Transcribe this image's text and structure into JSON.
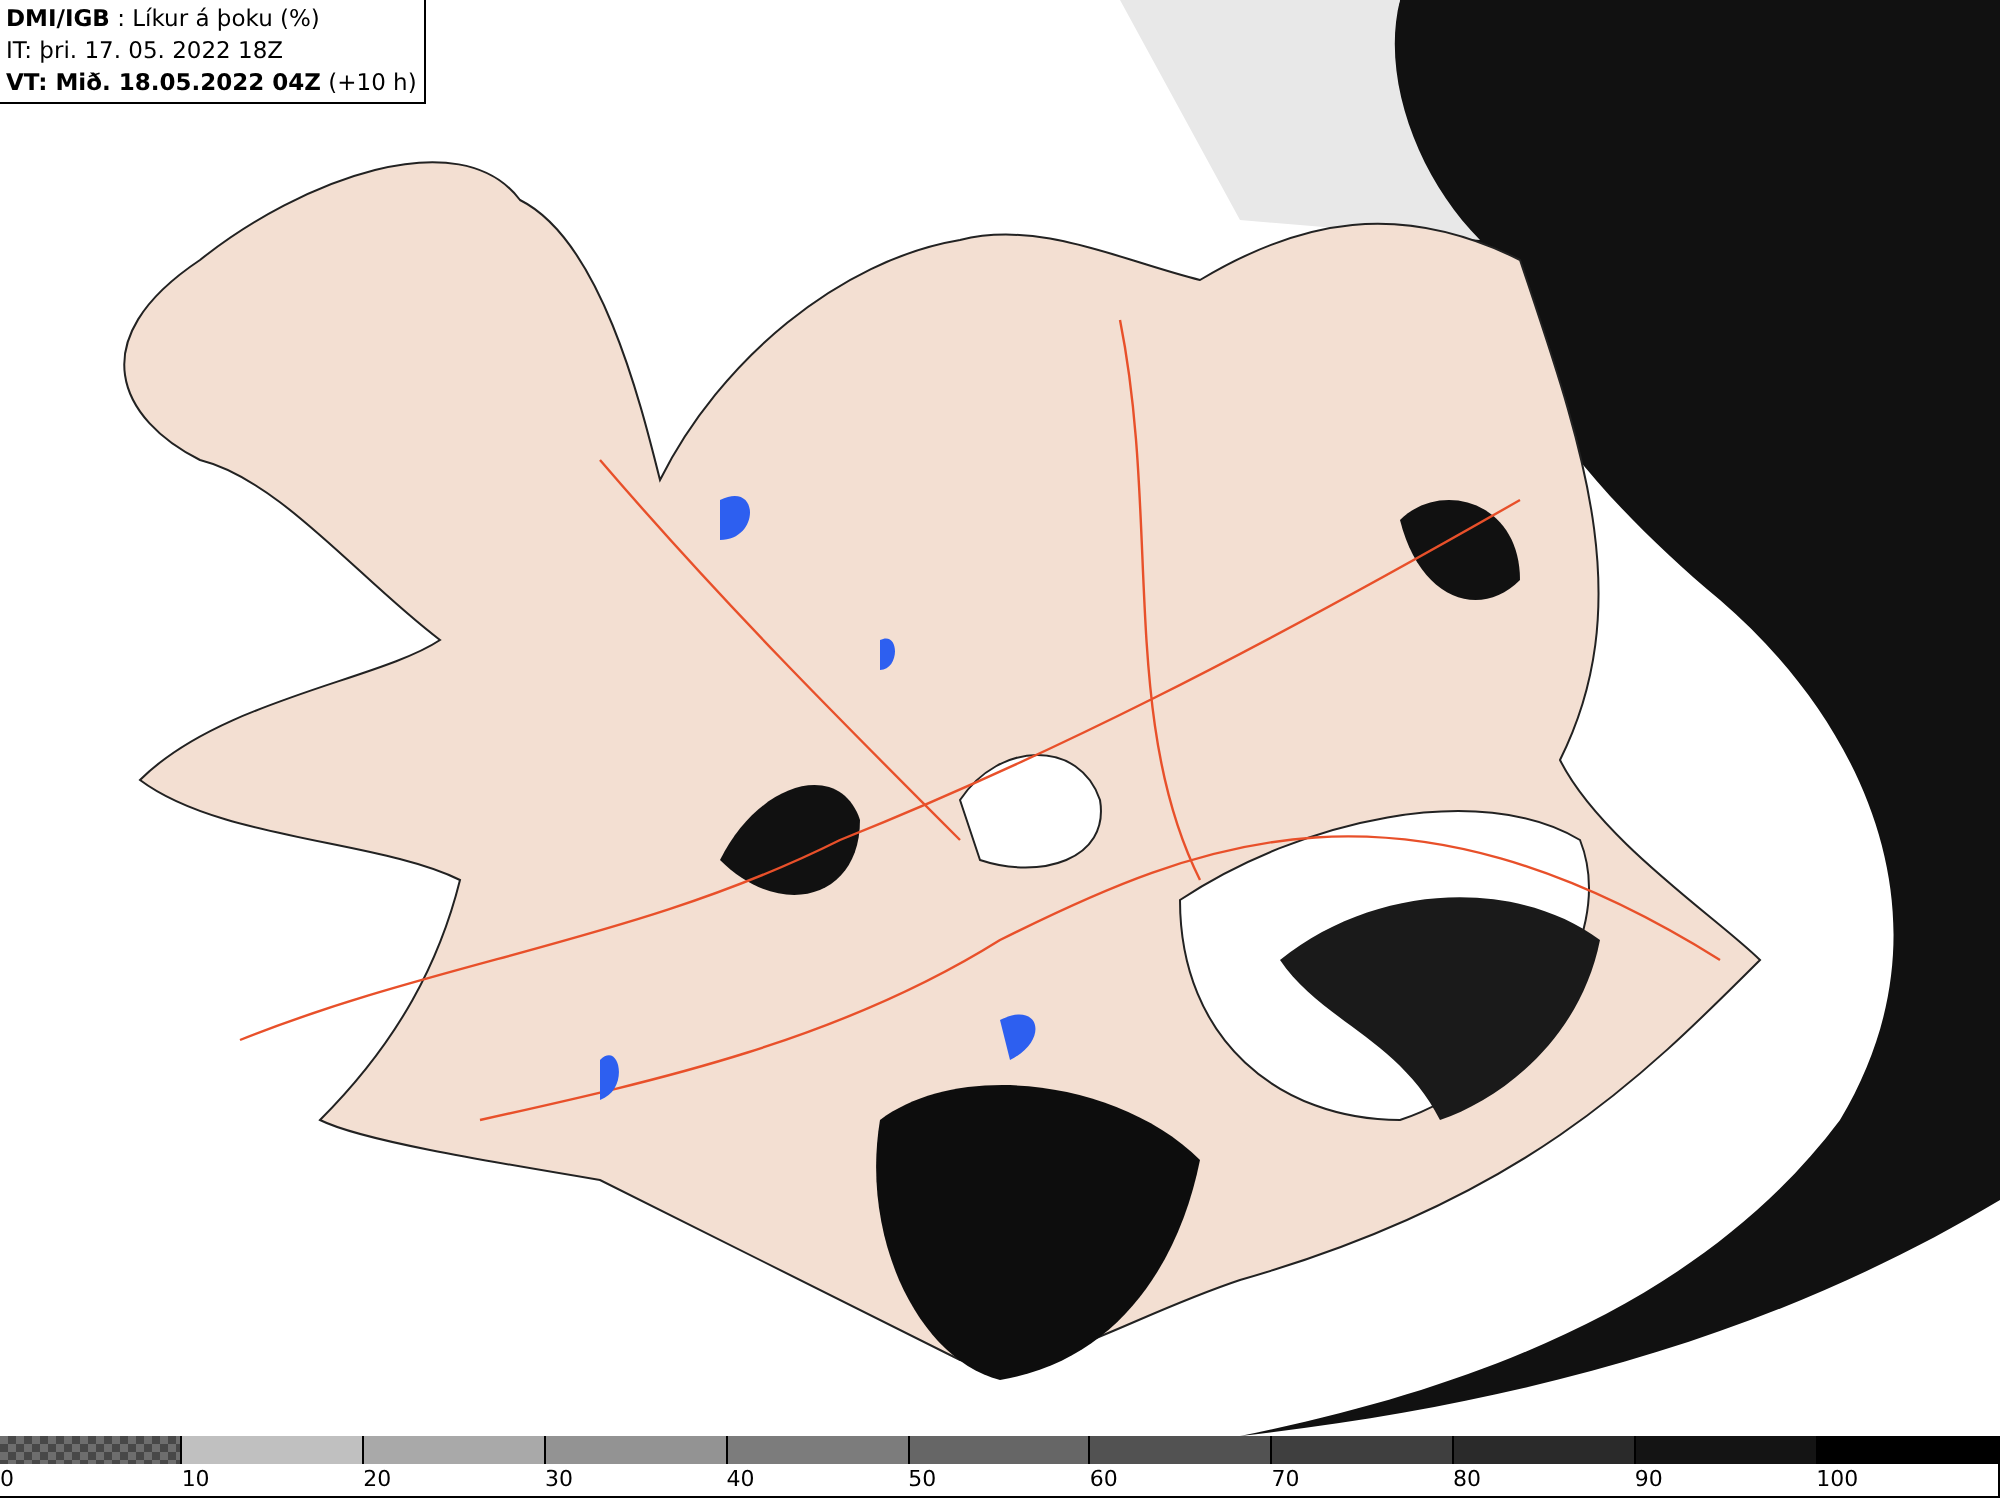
{
  "header": {
    "source": "DMI/IGB",
    "title": " : Líkur á þoku (%)",
    "issued": "IT: þri. 17. 05. 2022 18Z",
    "valid": "VT: Mið. 18.05.2022 04Z",
    "offset": " (+10 h)"
  },
  "legend": {
    "swatches": [
      {
        "kind": "checker",
        "color": "#6e6e6e",
        "label": "0"
      },
      {
        "kind": "solid",
        "color": "#c0c0c0",
        "label": "10"
      },
      {
        "kind": "solid",
        "color": "#a9a9a9",
        "label": "20"
      },
      {
        "kind": "solid",
        "color": "#939393",
        "label": "30"
      },
      {
        "kind": "solid",
        "color": "#7c7c7c",
        "label": "40"
      },
      {
        "kind": "solid",
        "color": "#666666",
        "label": "50"
      },
      {
        "kind": "solid",
        "color": "#525252",
        "label": "60"
      },
      {
        "kind": "solid",
        "color": "#3f3f3f",
        "label": "70"
      },
      {
        "kind": "solid",
        "color": "#2a2a2a",
        "label": "80"
      },
      {
        "kind": "solid",
        "color": "#141414",
        "label": "90"
      },
      {
        "kind": "solid",
        "color": "#000000",
        "label": "100"
      }
    ]
  }
}
